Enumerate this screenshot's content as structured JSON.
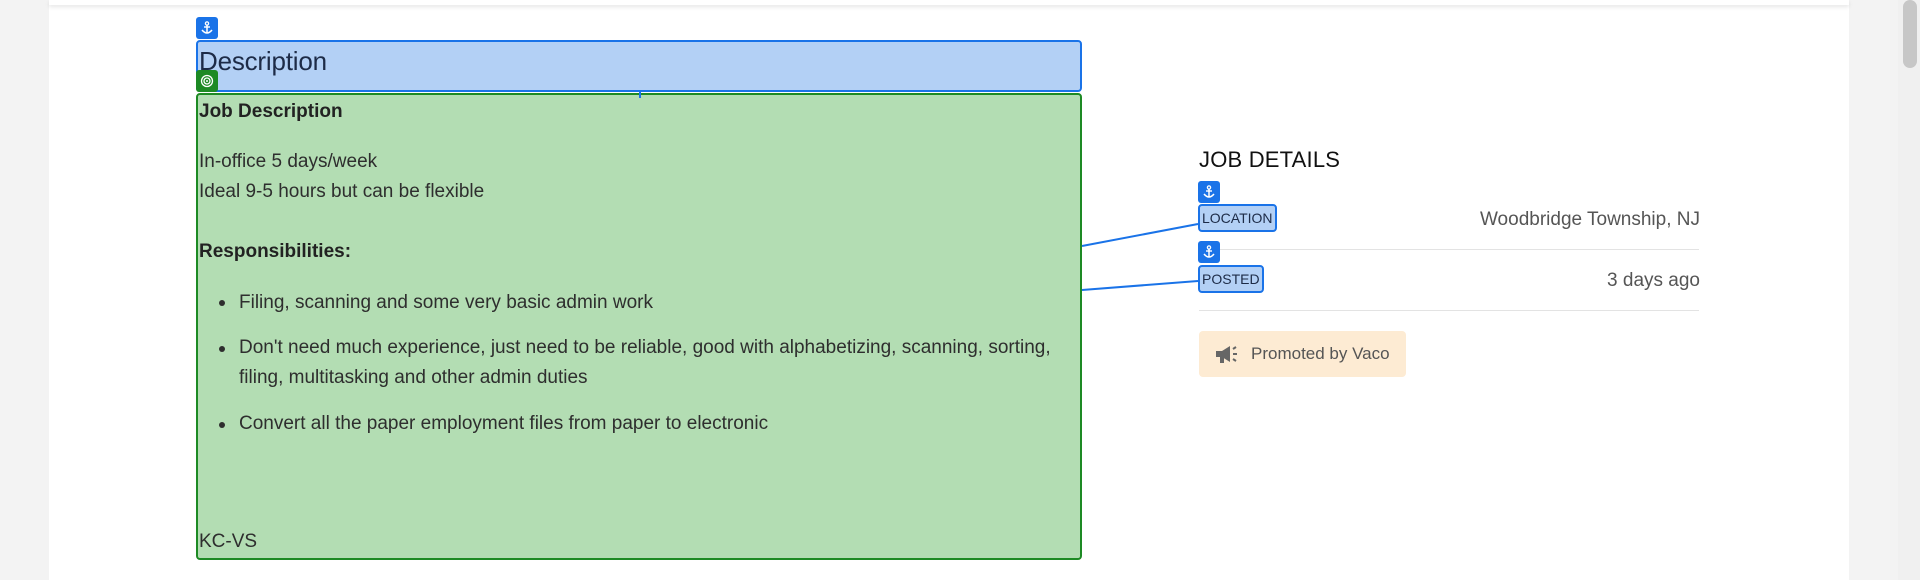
{
  "description": {
    "heading": "Description",
    "job_description_title": "Job Description",
    "lines": [
      "In-office 5 days/week",
      "Ideal 9-5 hours but can be flexible"
    ],
    "responsibilities_title": "Responsibilities:",
    "bullets": [
      "Filing, scanning and some very basic admin work",
      "Don't need much experience, just need to be reliable, good with alphabetizing, scanning, sorting, filing, multitasking and other admin duties",
      "Convert all the paper employment files from paper to electronic"
    ],
    "signoff": "KC-VS"
  },
  "job_details": {
    "title": "JOB DETAILS",
    "rows": [
      {
        "label": "LOCATION",
        "value": "Woodbridge Township, NJ"
      },
      {
        "label": "POSTED",
        "value": "3 days ago"
      }
    ]
  },
  "promo": {
    "text": "Promoted by Vaco",
    "icon": "megaphone-icon"
  },
  "colors": {
    "anchor_blue": "#1a73e8",
    "target_green": "#1d8a24",
    "promo_bg": "#fdebd3"
  }
}
